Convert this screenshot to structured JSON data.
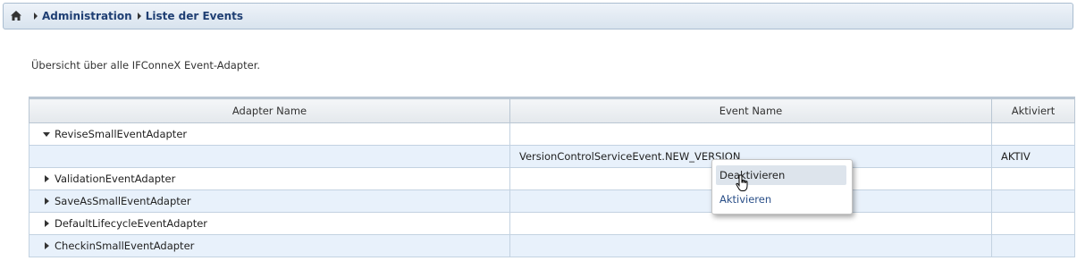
{
  "breadcrumb": {
    "home_icon": "home-icon",
    "items": [
      "Administration",
      "Liste der Events"
    ]
  },
  "intro_text": "Übersicht über alle IFConneX Event-Adapter.",
  "table": {
    "columns": [
      "Adapter Name",
      "Event Name",
      "Aktiviert"
    ],
    "rows": [
      {
        "adapter": "ReviseSmallEventAdapter",
        "expanded": true,
        "event": "",
        "active": ""
      },
      {
        "adapter": "",
        "event": "VersionControlServiceEvent.NEW_VERSION",
        "active": "AKTIV"
      },
      {
        "adapter": "ValidationEventAdapter",
        "expanded": false,
        "event": "",
        "active": ""
      },
      {
        "adapter": "SaveAsSmallEventAdapter",
        "expanded": false,
        "event": "",
        "active": ""
      },
      {
        "adapter": "DefaultLifecycleEventAdapter",
        "expanded": false,
        "event": "",
        "active": ""
      },
      {
        "adapter": "CheckinSmallEventAdapter",
        "expanded": false,
        "event": "",
        "active": ""
      }
    ]
  },
  "context_menu": {
    "items": [
      "Deaktivieren",
      "Aktivieren"
    ],
    "hovered_index": 0
  },
  "colors": {
    "link": "#1f3f73",
    "row_alt": "#e8f1fb",
    "menu_hover": "#dde4ec"
  }
}
